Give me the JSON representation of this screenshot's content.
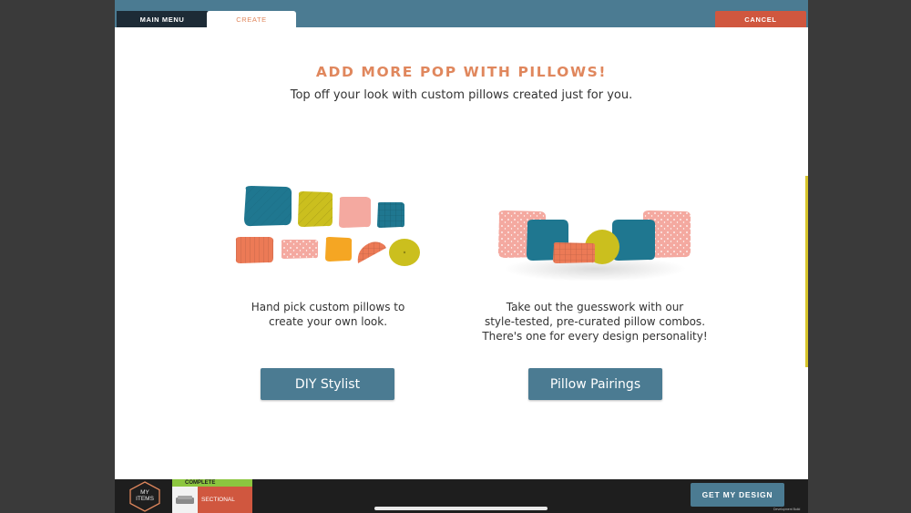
{
  "tabs": {
    "main_menu": "MAIN MENU",
    "create": "CREATE"
  },
  "cancel_label": "CANCEL",
  "hero": {
    "title": "ADD MORE POP WITH PILLOWS!",
    "subtitle": "Top off your look with custom pillows created just for you."
  },
  "options": [
    {
      "description": [
        "Hand pick custom pillows to",
        "create your own look."
      ],
      "button": "DIY Stylist"
    },
    {
      "description": [
        "Take out the guesswork with our",
        "style-tested, pre-curated pillow combos.",
        "There's one for every design personality!"
      ],
      "button": "Pillow Pairings"
    }
  ],
  "bottom": {
    "my_items": [
      "MY",
      "ITEMS"
    ],
    "status": "COMPLETE",
    "item_name": "SECTIONAL",
    "get_design": "GET MY DESIGN",
    "build_note": "Development Build"
  },
  "colors": {
    "teal": "#4b7b92",
    "navy": "#1d2b36",
    "orange": "#e0875d",
    "red": "#d0573f",
    "green": "#8cc63f",
    "yellow": "#d7c52b"
  }
}
